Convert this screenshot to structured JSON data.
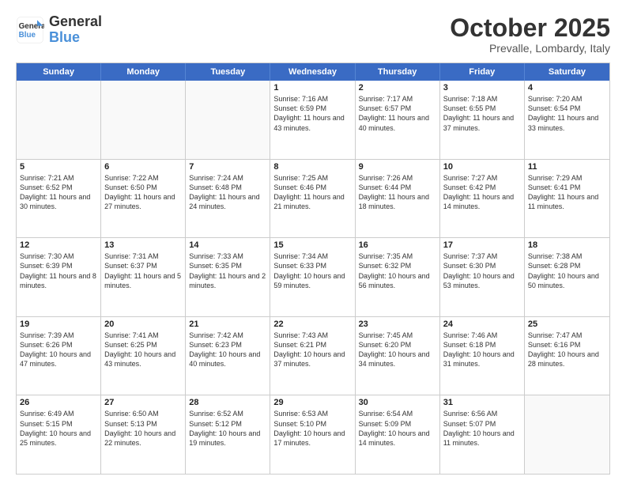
{
  "logo": {
    "line1": "General",
    "line2": "Blue"
  },
  "title": "October 2025",
  "location": "Prevalle, Lombardy, Italy",
  "header": {
    "days": [
      "Sunday",
      "Monday",
      "Tuesday",
      "Wednesday",
      "Thursday",
      "Friday",
      "Saturday"
    ]
  },
  "weeks": [
    [
      {
        "day": "",
        "text": ""
      },
      {
        "day": "",
        "text": ""
      },
      {
        "day": "",
        "text": ""
      },
      {
        "day": "1",
        "text": "Sunrise: 7:16 AM\nSunset: 6:59 PM\nDaylight: 11 hours and 43 minutes."
      },
      {
        "day": "2",
        "text": "Sunrise: 7:17 AM\nSunset: 6:57 PM\nDaylight: 11 hours and 40 minutes."
      },
      {
        "day": "3",
        "text": "Sunrise: 7:18 AM\nSunset: 6:55 PM\nDaylight: 11 hours and 37 minutes."
      },
      {
        "day": "4",
        "text": "Sunrise: 7:20 AM\nSunset: 6:54 PM\nDaylight: 11 hours and 33 minutes."
      }
    ],
    [
      {
        "day": "5",
        "text": "Sunrise: 7:21 AM\nSunset: 6:52 PM\nDaylight: 11 hours and 30 minutes."
      },
      {
        "day": "6",
        "text": "Sunrise: 7:22 AM\nSunset: 6:50 PM\nDaylight: 11 hours and 27 minutes."
      },
      {
        "day": "7",
        "text": "Sunrise: 7:24 AM\nSunset: 6:48 PM\nDaylight: 11 hours and 24 minutes."
      },
      {
        "day": "8",
        "text": "Sunrise: 7:25 AM\nSunset: 6:46 PM\nDaylight: 11 hours and 21 minutes."
      },
      {
        "day": "9",
        "text": "Sunrise: 7:26 AM\nSunset: 6:44 PM\nDaylight: 11 hours and 18 minutes."
      },
      {
        "day": "10",
        "text": "Sunrise: 7:27 AM\nSunset: 6:42 PM\nDaylight: 11 hours and 14 minutes."
      },
      {
        "day": "11",
        "text": "Sunrise: 7:29 AM\nSunset: 6:41 PM\nDaylight: 11 hours and 11 minutes."
      }
    ],
    [
      {
        "day": "12",
        "text": "Sunrise: 7:30 AM\nSunset: 6:39 PM\nDaylight: 11 hours and 8 minutes."
      },
      {
        "day": "13",
        "text": "Sunrise: 7:31 AM\nSunset: 6:37 PM\nDaylight: 11 hours and 5 minutes."
      },
      {
        "day": "14",
        "text": "Sunrise: 7:33 AM\nSunset: 6:35 PM\nDaylight: 11 hours and 2 minutes."
      },
      {
        "day": "15",
        "text": "Sunrise: 7:34 AM\nSunset: 6:33 PM\nDaylight: 10 hours and 59 minutes."
      },
      {
        "day": "16",
        "text": "Sunrise: 7:35 AM\nSunset: 6:32 PM\nDaylight: 10 hours and 56 minutes."
      },
      {
        "day": "17",
        "text": "Sunrise: 7:37 AM\nSunset: 6:30 PM\nDaylight: 10 hours and 53 minutes."
      },
      {
        "day": "18",
        "text": "Sunrise: 7:38 AM\nSunset: 6:28 PM\nDaylight: 10 hours and 50 minutes."
      }
    ],
    [
      {
        "day": "19",
        "text": "Sunrise: 7:39 AM\nSunset: 6:26 PM\nDaylight: 10 hours and 47 minutes."
      },
      {
        "day": "20",
        "text": "Sunrise: 7:41 AM\nSunset: 6:25 PM\nDaylight: 10 hours and 43 minutes."
      },
      {
        "day": "21",
        "text": "Sunrise: 7:42 AM\nSunset: 6:23 PM\nDaylight: 10 hours and 40 minutes."
      },
      {
        "day": "22",
        "text": "Sunrise: 7:43 AM\nSunset: 6:21 PM\nDaylight: 10 hours and 37 minutes."
      },
      {
        "day": "23",
        "text": "Sunrise: 7:45 AM\nSunset: 6:20 PM\nDaylight: 10 hours and 34 minutes."
      },
      {
        "day": "24",
        "text": "Sunrise: 7:46 AM\nSunset: 6:18 PM\nDaylight: 10 hours and 31 minutes."
      },
      {
        "day": "25",
        "text": "Sunrise: 7:47 AM\nSunset: 6:16 PM\nDaylight: 10 hours and 28 minutes."
      }
    ],
    [
      {
        "day": "26",
        "text": "Sunrise: 6:49 AM\nSunset: 5:15 PM\nDaylight: 10 hours and 25 minutes."
      },
      {
        "day": "27",
        "text": "Sunrise: 6:50 AM\nSunset: 5:13 PM\nDaylight: 10 hours and 22 minutes."
      },
      {
        "day": "28",
        "text": "Sunrise: 6:52 AM\nSunset: 5:12 PM\nDaylight: 10 hours and 19 minutes."
      },
      {
        "day": "29",
        "text": "Sunrise: 6:53 AM\nSunset: 5:10 PM\nDaylight: 10 hours and 17 minutes."
      },
      {
        "day": "30",
        "text": "Sunrise: 6:54 AM\nSunset: 5:09 PM\nDaylight: 10 hours and 14 minutes."
      },
      {
        "day": "31",
        "text": "Sunrise: 6:56 AM\nSunset: 5:07 PM\nDaylight: 10 hours and 11 minutes."
      },
      {
        "day": "",
        "text": ""
      }
    ]
  ]
}
